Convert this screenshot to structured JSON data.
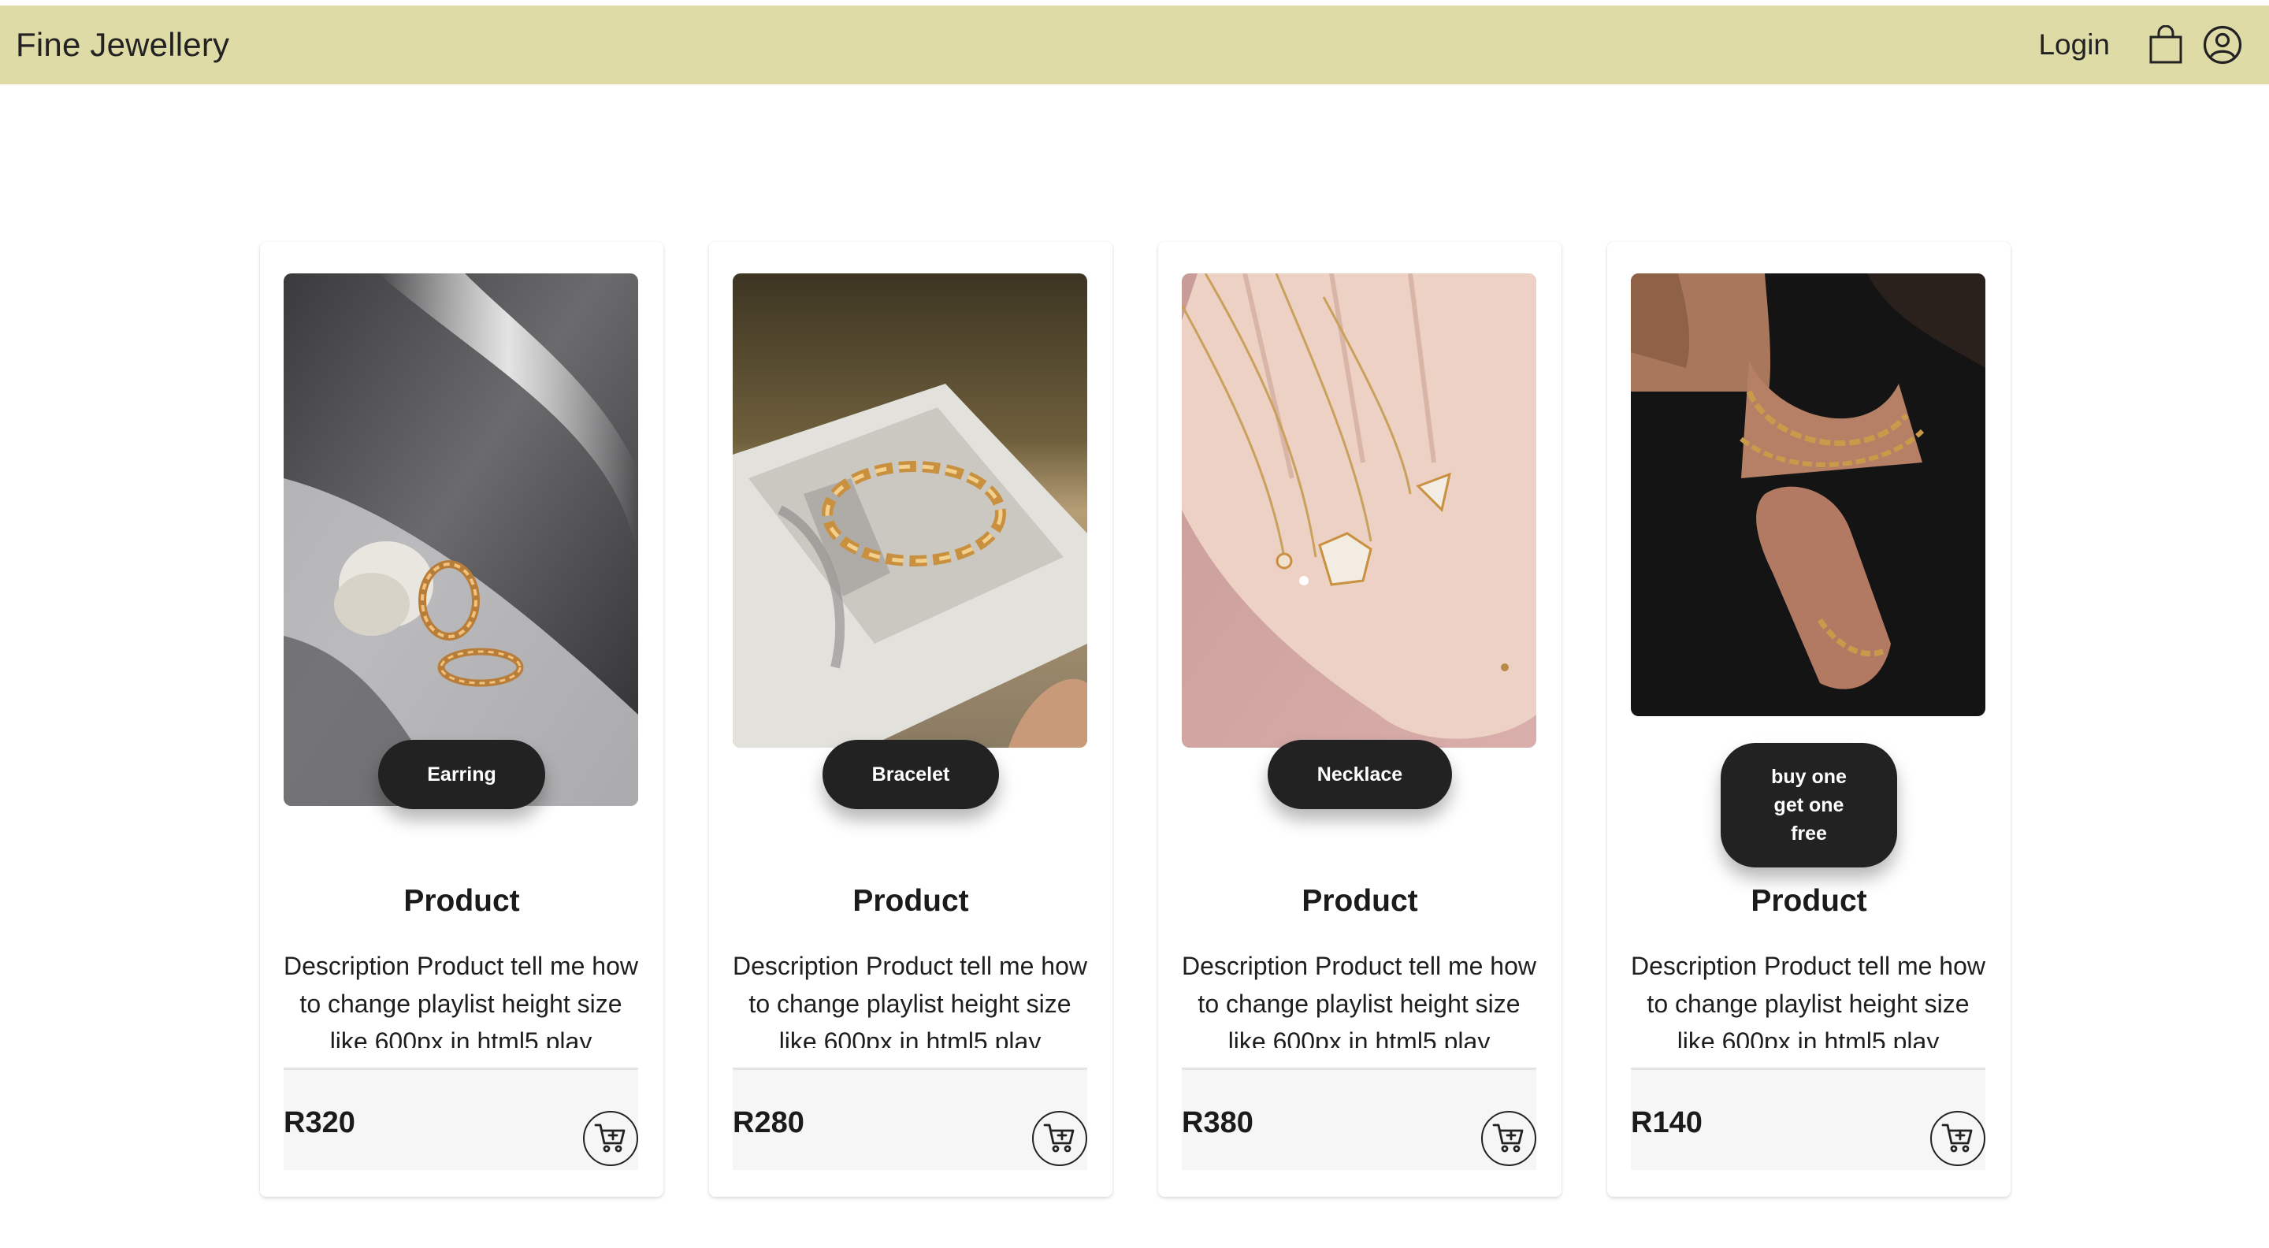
{
  "navbar": {
    "brand": "Fine Jewellery",
    "login_label": "Login",
    "bag_icon": "shopping-bag-icon",
    "account_icon": "person-circle-icon",
    "background": "#dfdba6"
  },
  "products": [
    {
      "category": "Earring",
      "title": "Product",
      "description": "Description Product tell me how to change playlist height size like 600px in html5 play",
      "price": "R320",
      "image": "gold twisted hoop earrings on stone with dramatic shadows"
    },
    {
      "category": "Bracelet",
      "title": "Product",
      "description": "Description Product tell me how to change playlist height size like 600px in html5 play",
      "price": "R280",
      "image": "gold chain bracelet on open magazine"
    },
    {
      "category": "Necklace",
      "title": "Product",
      "description": "Description Product tell me how to change playlist height size like 600px in html5 play",
      "price": "R380",
      "image": "gold pendant necklaces in open palm"
    },
    {
      "category": "buy one get one free",
      "title": "Product",
      "description": "Description Product tell me how to change playlist height size like 600px in html5 play",
      "price": "R140",
      "image": "woman wearing gold chain necklace and bracelet on black top"
    }
  ],
  "icons": {
    "cart": "cart-plus-icon"
  },
  "colors": {
    "badge": "#222222",
    "footer": "#f6f6f6"
  }
}
